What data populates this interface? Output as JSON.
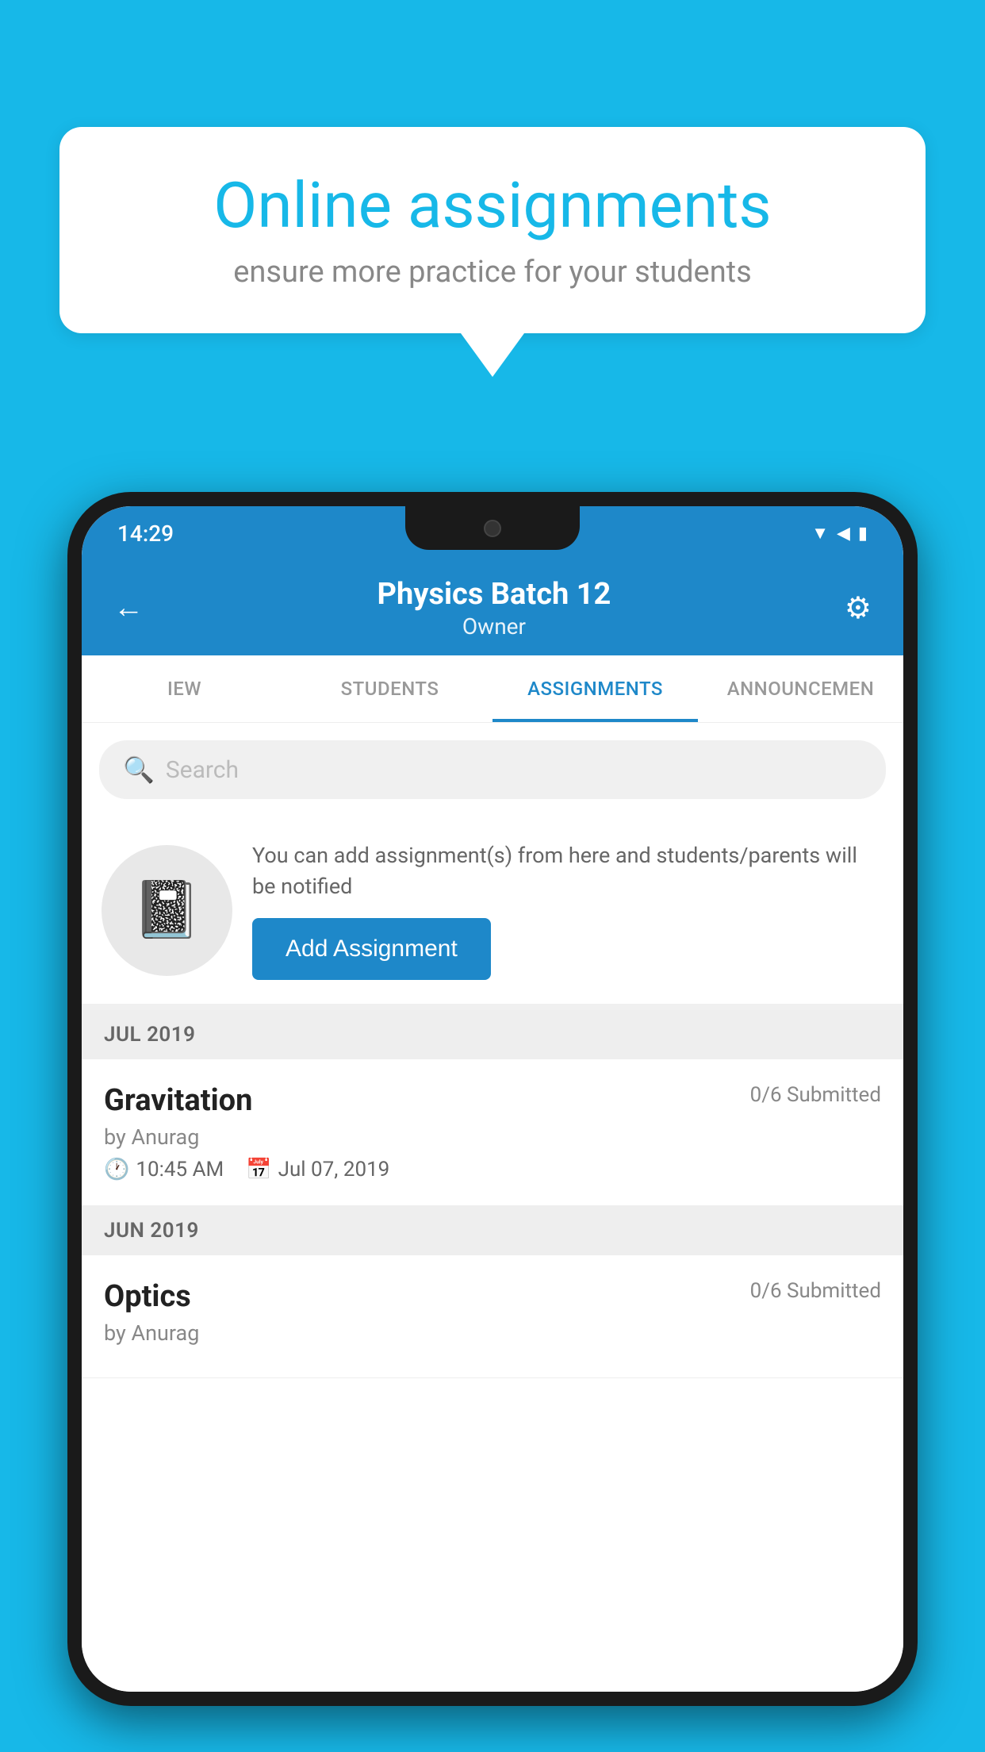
{
  "background_color": "#17b8e8",
  "speech_bubble": {
    "title": "Online assignments",
    "subtitle": "ensure more practice for your students"
  },
  "status_bar": {
    "time": "14:29",
    "icons": [
      "wifi",
      "signal",
      "battery"
    ]
  },
  "app_header": {
    "title": "Physics Batch 12",
    "subtitle": "Owner",
    "back_label": "←",
    "settings_label": "⚙"
  },
  "tabs": [
    {
      "label": "IEW",
      "active": false
    },
    {
      "label": "STUDENTS",
      "active": false
    },
    {
      "label": "ASSIGNMENTS",
      "active": true
    },
    {
      "label": "ANNOUNCEMEN",
      "active": false
    }
  ],
  "search": {
    "placeholder": "Search"
  },
  "promo": {
    "description": "You can add assignment(s) from here and students/parents will be notified",
    "button_label": "Add Assignment"
  },
  "sections": [
    {
      "label": "JUL 2019",
      "assignments": [
        {
          "name": "Gravitation",
          "submitted": "0/6 Submitted",
          "author": "by Anurag",
          "time": "10:45 AM",
          "date": "Jul 07, 2019"
        }
      ]
    },
    {
      "label": "JUN 2019",
      "assignments": [
        {
          "name": "Optics",
          "submitted": "0/6 Submitted",
          "author": "by Anurag",
          "time": "",
          "date": ""
        }
      ]
    }
  ]
}
